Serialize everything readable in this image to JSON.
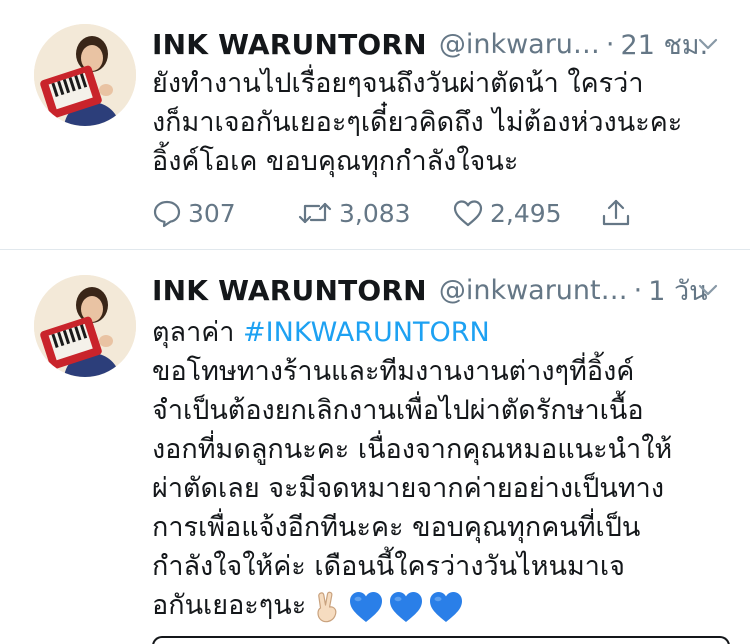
{
  "tweets": [
    {
      "author_name": "INK WARUNTORN",
      "handle": "@inkwaru…",
      "separator": "·",
      "time": "21 ชม.",
      "lines": [
        "ยังทำงานไปเรื่อยๆจนถึงวันผ่าตัดน้า ใครว่า",
        "งก็มาเจอกันเยอะๆเดี๋ยวคิดถึง ไม่ต้องห่วงนะคะ",
        "อิ้งค์โอเค ขอบคุณทุกกำลังใจนะ"
      ],
      "stats": {
        "replies": "307",
        "retweets": "3,083",
        "likes": "2,495"
      },
      "icons": {
        "reply": "reply-icon",
        "retweet": "retweet-icon",
        "like": "heart-icon",
        "share": "share-icon",
        "menu": "chevron-down-icon"
      }
    },
    {
      "author_name": "INK WARUNTORN",
      "handle": "@inkwarunt…",
      "separator": "·",
      "time": "1 วัน",
      "first_line_text": "ตุลาค่า ",
      "hashtag": "#INKWARUNTORN",
      "lines": [
        "ขอโทษทางร้านและทีมงานงานต่างๆที่อิ้งค์",
        "จำเป็นต้องยกเลิกงานเพื่อไปผ่าตัดรักษาเนื้อ",
        "งอกที่มดลูกนะคะ เนื่องจากคุณหมอแนะนำให้",
        "ผ่าตัดเลย จะมีจดหมายจากค่ายอย่างเป็นทาง",
        "การเพื่อแจ้งอีกทีนะคะ ขอบคุณทุกคนที่เป็น",
        "กำลังใจให้ค่ะ เดือนนี้ใครว่างวันไหนมาเจ"
      ],
      "last_line_text": "อกันเยอะๆนะ",
      "emojis": [
        "victory-hand-icon",
        "blue-heart-icon",
        "blue-heart-icon",
        "blue-heart-icon"
      ]
    }
  ],
  "colors": {
    "text": "#14171a",
    "secondary": "#657786",
    "link": "#1da1f2",
    "divider": "#e1e8ed",
    "heart_emoji": "#2a7fe8"
  }
}
